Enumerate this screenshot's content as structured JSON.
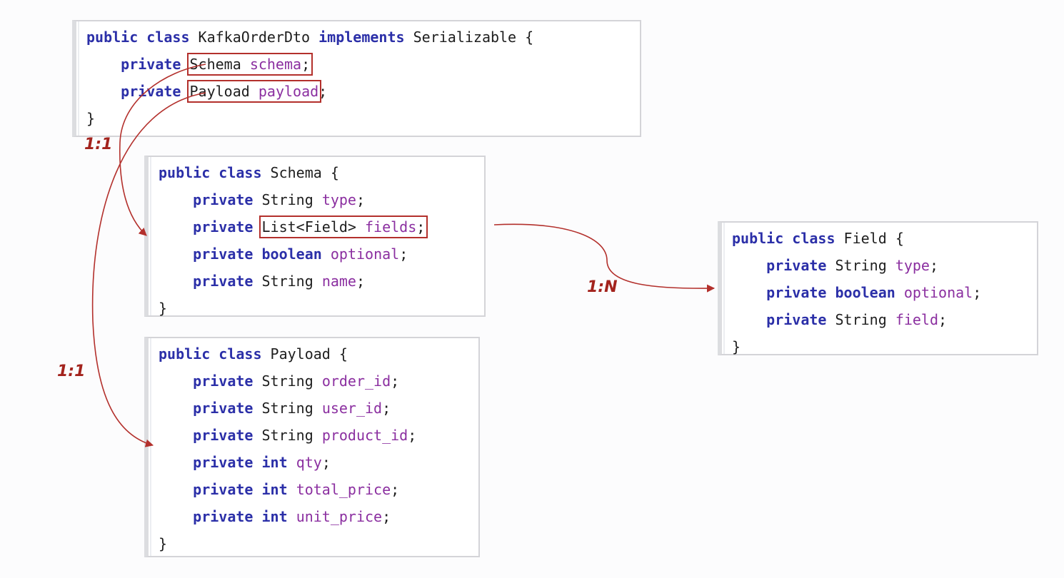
{
  "classes": {
    "kafka_order_dto": {
      "header": {
        "kw": "public class",
        "name": "KafkaOrderDto",
        "implements": "implements",
        "iface": "Serializable",
        "brace": "{"
      },
      "fields": [
        {
          "mod": "private",
          "type": "Schema",
          "name": "schema",
          "end": ";"
        },
        {
          "mod": "private",
          "type": "Payload",
          "name": "payload",
          "end": ";"
        }
      ],
      "close": "}"
    },
    "schema": {
      "header": {
        "kw": "public class",
        "name": "Schema",
        "brace": "{"
      },
      "fields": [
        {
          "mod": "private",
          "type": "String",
          "name": "type",
          "end": ";"
        },
        {
          "mod": "private",
          "type": "List<Field>",
          "name": "fields",
          "end": ";"
        },
        {
          "mod": "private",
          "type": "boolean",
          "name": "optional",
          "end": ";"
        },
        {
          "mod": "private",
          "type": "String",
          "name": "name",
          "end": ";"
        }
      ],
      "close": "}"
    },
    "payload": {
      "header": {
        "kw": "public class",
        "name": "Payload",
        "brace": "{"
      },
      "fields": [
        {
          "mod": "private",
          "type": "String",
          "name": "order_id",
          "end": ";"
        },
        {
          "mod": "private",
          "type": "String",
          "name": "user_id",
          "end": ";"
        },
        {
          "mod": "private",
          "type": "String",
          "name": "product_id",
          "end": ";"
        },
        {
          "mod": "private",
          "type": "int",
          "name": "qty",
          "end": ";"
        },
        {
          "mod": "private",
          "type": "int",
          "name": "total_price",
          "end": ";"
        },
        {
          "mod": "private",
          "type": "int",
          "name": "unit_price",
          "end": ";"
        }
      ],
      "close": "}"
    },
    "field": {
      "header": {
        "kw": "public class",
        "name": "Field",
        "brace": "{"
      },
      "fields": [
        {
          "mod": "private",
          "type": "String",
          "name": "type",
          "end": ";"
        },
        {
          "mod": "private",
          "type": "boolean",
          "name": "optional",
          "end": ";"
        },
        {
          "mod": "private",
          "type": "String",
          "name": "field",
          "end": ";"
        }
      ],
      "close": "}"
    }
  },
  "relations": [
    {
      "label": "1:1",
      "from": "KafkaOrderDto.schema",
      "to": "Schema"
    },
    {
      "label": "1:1",
      "from": "KafkaOrderDto.payload",
      "to": "Payload"
    },
    {
      "label": "1:N",
      "from": "Schema.fields",
      "to": "Field"
    }
  ],
  "colors": {
    "keyword": "#2b2fa8",
    "identifier": "#8b2fa0",
    "arrow": "#b3302c",
    "ratio_label": "#a3231d"
  }
}
